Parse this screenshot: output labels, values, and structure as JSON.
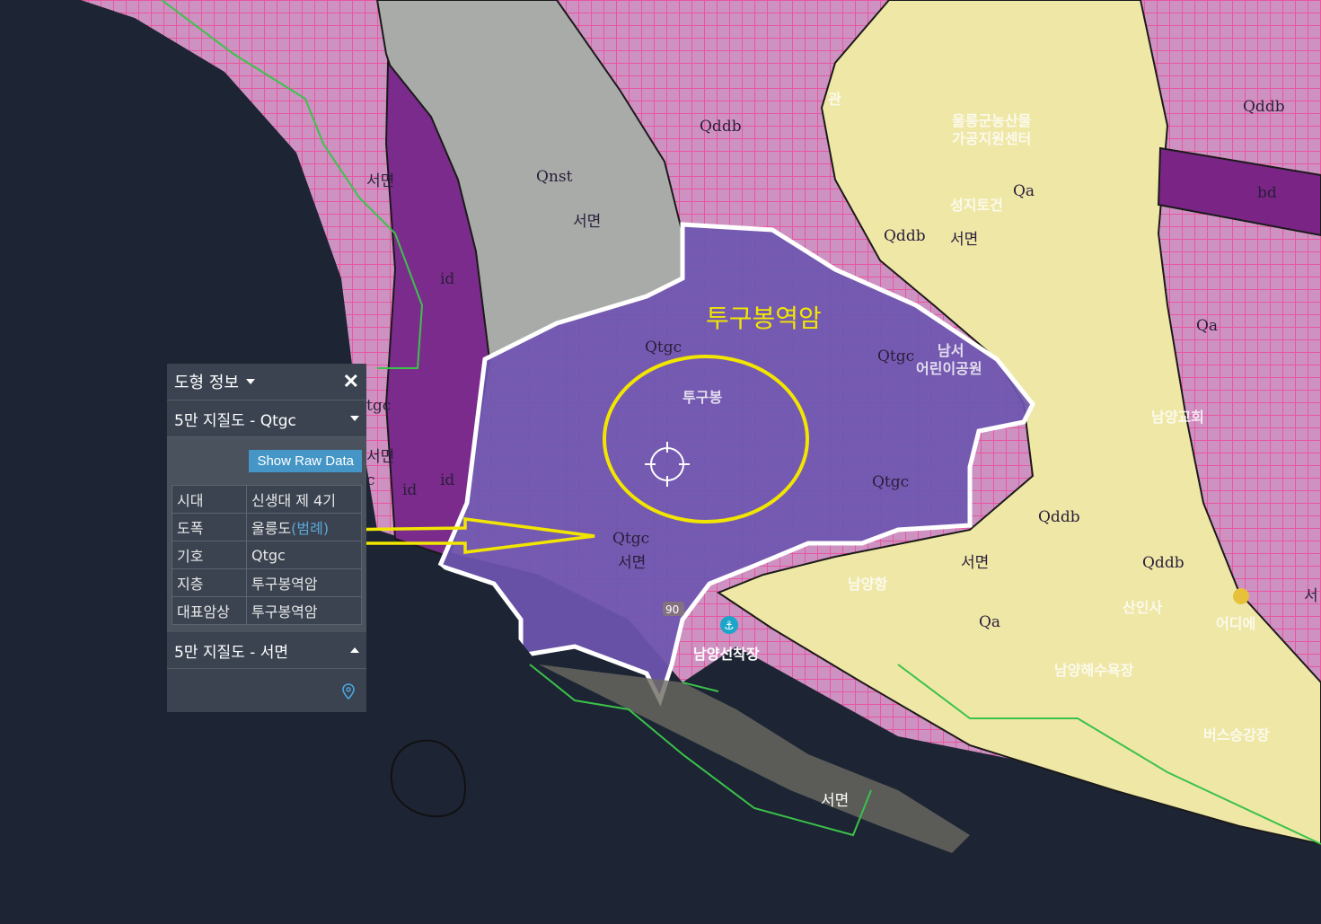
{
  "map": {
    "unit_labels": {
      "qddb_1": "Qddb",
      "qddb_2": "Qddb",
      "qddb_3": "Qddb",
      "qddb_4": "Qddb",
      "qddb_5": "Qddb",
      "qnst": "Qnst",
      "id_1": "id",
      "id_2": "id",
      "id_3": "id",
      "qtgc_1": "Qtgc",
      "qtgc_2": "Qtgc",
      "qtgc_3": "Qtgc",
      "qtgc_4": "Qtgc",
      "qa_1": "Qa",
      "qa_2": "Qa",
      "qa_3": "Qa",
      "bd": "bd",
      "tgc_partial": "tgc",
      "c_partial": "c"
    },
    "district_labels": {
      "seomyeon_1": "서면",
      "seomyeon_2": "서면",
      "seomyeon_3": "서면",
      "seomyeon_4": "서면",
      "seomyeon_5": "서면",
      "seomyeon_6": "서면",
      "seomyeon_7": "서면",
      "seo_partial": "서"
    },
    "place_labels": {
      "tugubong": "투구봉",
      "namyang_port": "남양선착장",
      "agri_center_1": "울릉군농산물",
      "agri_center_2": "가공지원센터",
      "namseo_1": "남서",
      "namseo_2": "어린이공원",
      "namyang_church": "남양교회",
      "seongji": "성지토건",
      "namyanghang": "남양항",
      "beach": "남양해수욕장",
      "bus": "버스승강장",
      "hall": "관",
      "road_no": "90",
      "sanin": "산인사",
      "eodi": "어디에"
    },
    "annotation": "투구봉역암"
  },
  "panel": {
    "title": "도형 정보",
    "close_label": "✕",
    "section1_title": "5만 지질도 - Qtgc",
    "raw_button": "Show Raw Data",
    "rows": [
      {
        "key": "시대",
        "value": "신생대 제 4기"
      },
      {
        "key": "도폭",
        "value": "울릉도",
        "link": "(범례)"
      },
      {
        "key": "기호",
        "value": "Qtgc"
      },
      {
        "key": "지층",
        "value": "투구봉역암"
      },
      {
        "key": "대표암상",
        "value": "투구봉역암"
      }
    ],
    "section2_title": "5만 지질도 - 서면"
  },
  "colors": {
    "qddb": "#d593c6",
    "qddb_grid": "#ff5ca8",
    "qa": "#f0e9a8",
    "qnst": "#a8aaa8",
    "id": "#7a2a8a",
    "qtgc": "#6e56b0",
    "sea": "#1d2433",
    "highlight": "#f2e600",
    "panel": "#3b4350",
    "button": "#4596c7"
  }
}
